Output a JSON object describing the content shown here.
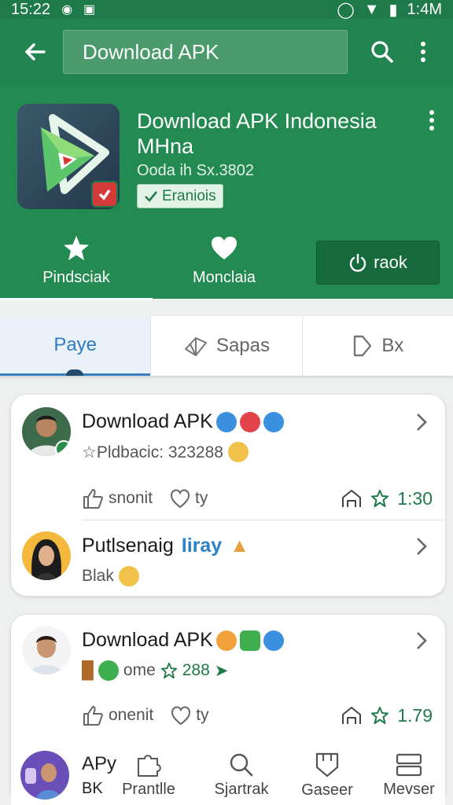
{
  "status_bar": {
    "time": "15:22",
    "right_time": "1:4M"
  },
  "app_bar": {
    "search_text": "Download APK"
  },
  "hero": {
    "title": "Download APK Indonesia MHna",
    "subtitle": "Ooda ih Sx.3802",
    "verified_label": "Eraniois",
    "tabs": [
      {
        "label": "Pindsciak"
      },
      {
        "label": "Monclaia"
      }
    ],
    "action_label": "raok"
  },
  "tabs": [
    {
      "label": "Paye"
    },
    {
      "label": "Sapas"
    },
    {
      "label": "Bx"
    }
  ],
  "card1": {
    "item1": {
      "name": "Download APK",
      "meta": "☆Pldbacic: 323288",
      "like_label": "snonit",
      "heart_label": "ty",
      "score": "1:30"
    },
    "item2": {
      "name": "Putlsenaig",
      "highlight": "Iiray",
      "meta": "Blak"
    }
  },
  "card2": {
    "item1": {
      "name": "Download APK",
      "meta_text": "ome",
      "meta_score": "288",
      "like_label": "onenit",
      "heart_label": "ty",
      "score": "1.79"
    }
  },
  "bottom_nav": {
    "profile_title": "APy",
    "profile_sub": "BK",
    "items": [
      {
        "label": "Prantlle"
      },
      {
        "label": "Sjartrak"
      },
      {
        "label": "Gaseer"
      },
      {
        "label": "Mevser"
      }
    ]
  },
  "colors": {
    "primary": "#22844f",
    "primary_dark": "#176a3c",
    "accent_blue": "#2f7cc4",
    "background": "#eef0ef"
  }
}
